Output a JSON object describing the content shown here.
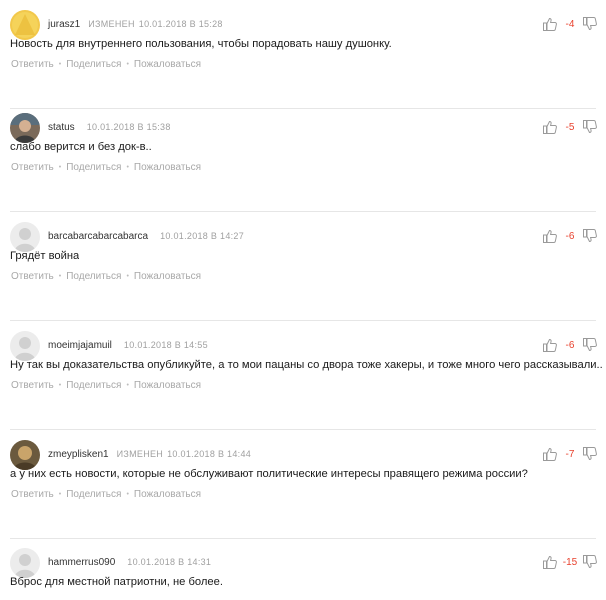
{
  "colors": {
    "negative_score": "#e8412d",
    "meta_gray": "#a0a0a0",
    "action_gray": "#a8a8a8"
  },
  "actions": {
    "reply": "Ответить",
    "share": "Поделиться",
    "report": "Пожаловаться"
  },
  "comments": [
    {
      "username": "jurasz1",
      "edited": "ИЗМЕНЕН",
      "date": "10.01.2018 В 15:28",
      "score": "-4",
      "text": "Новость для внутреннего пользования, чтобы порадовать нашу душонку.",
      "avatar": "yellow-avatar-icon"
    },
    {
      "username": "status",
      "edited": "",
      "date": "10.01.2018 В 15:38",
      "score": "-5",
      "text": "слабо верится и без док-в..",
      "avatar": "photo-avatar-icon"
    },
    {
      "username": "barcabarcabarcabarca",
      "edited": "",
      "date": "10.01.2018 В 14:27",
      "score": "-6",
      "text": "Грядёт война",
      "avatar": "default-avatar-icon"
    },
    {
      "username": "moeimjajamuil",
      "edited": "",
      "date": "10.01.2018 В 14:55",
      "score": "-6",
      "text": "Ну так вы доказательства опубликуйте, а то мои пацаны со двора тоже хакеры, и тоже много чего рассказывали...",
      "avatar": "default-avatar-icon"
    },
    {
      "username": "zmeyplisken1",
      "edited": "ИЗМЕНЕН",
      "date": "10.01.2018 В 14:44",
      "score": "-7",
      "text": "а у них есть новости, которые не обслуживают политические интересы правящего режима россии?",
      "avatar": "photo-avatar-icon"
    },
    {
      "username": "hammerrus090",
      "edited": "",
      "date": "10.01.2018 В 14:31",
      "score": "-15",
      "text": "Вброс для местной патриотни, не более.",
      "avatar": "default-avatar-icon"
    }
  ]
}
